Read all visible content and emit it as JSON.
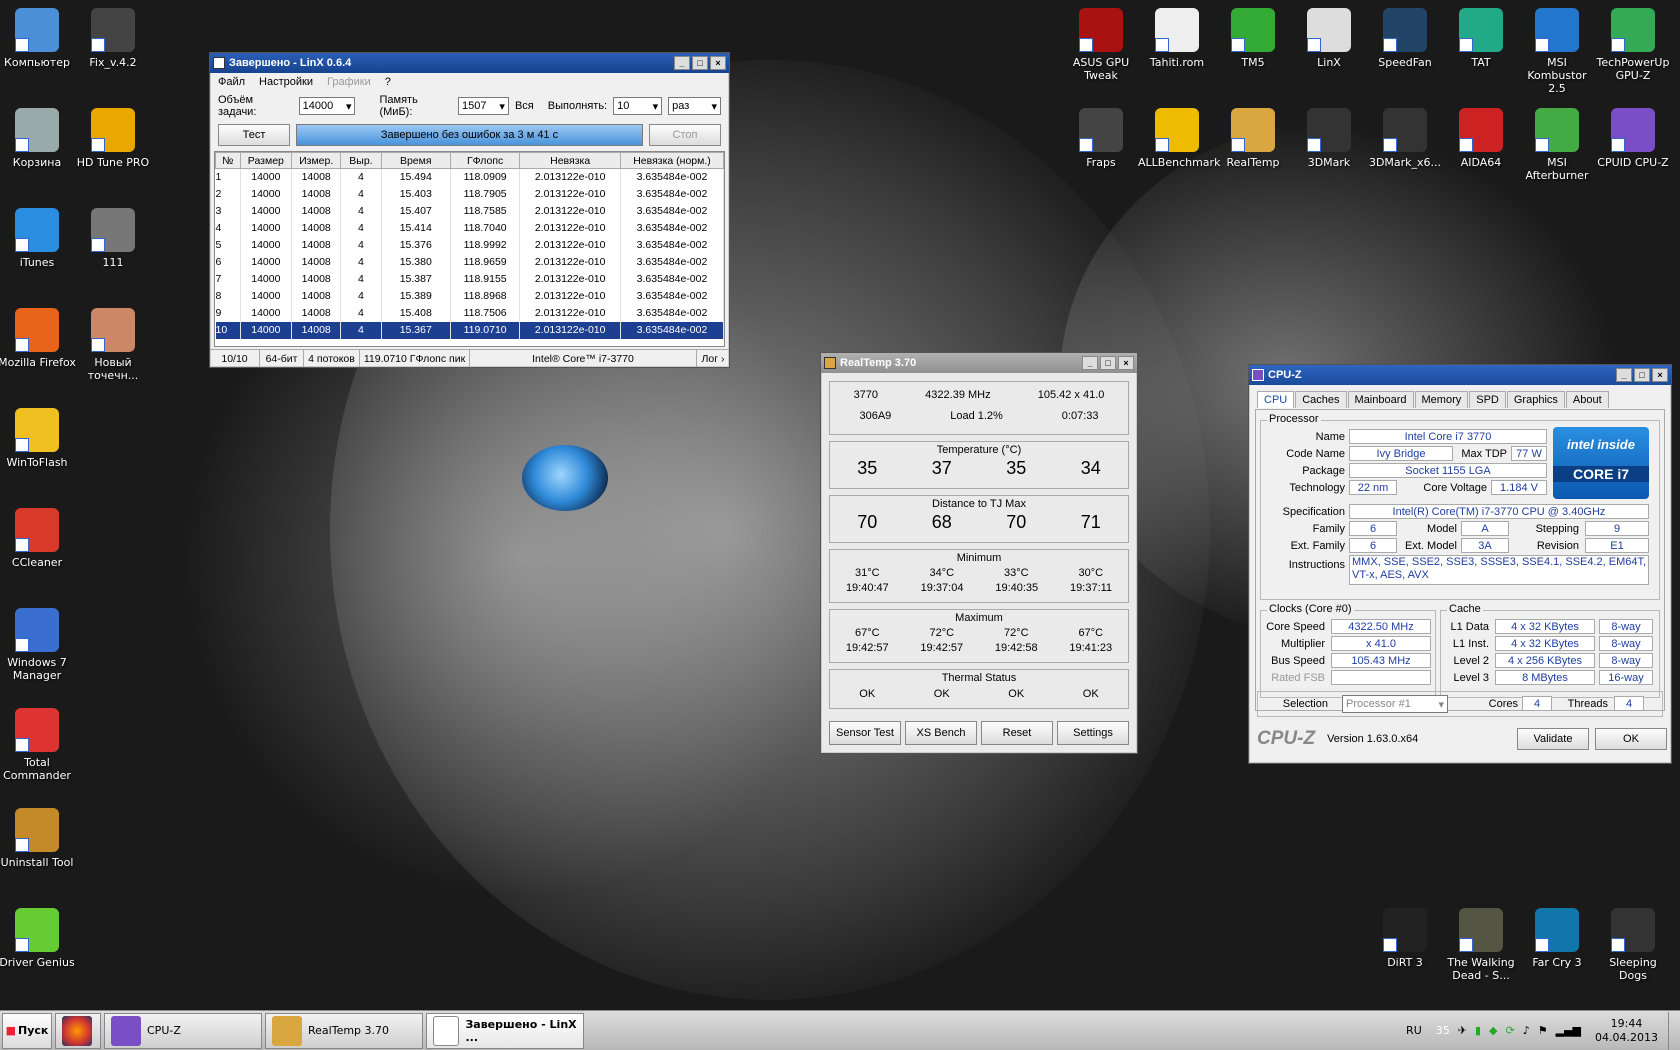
{
  "desktop": {
    "left_icons": [
      "Компьютер",
      "Корзина",
      "iTunes",
      "Mozilla Firefox",
      "WinToFlash",
      "CCleaner",
      "Windows 7 Manager",
      "Total Commander",
      "Uninstall Tool",
      "Driver Genius"
    ],
    "left2_icons": [
      "Fix_v.4.2",
      "HD Tune PRO",
      "111",
      "Новый точечн..."
    ],
    "top_icons": [
      "ASUS GPU Tweak",
      "Tahiti.rom",
      "TM5",
      "LinX",
      "SpeedFan",
      "TAT",
      "MSI Kombustor 2.5",
      "TechPowerUp GPU-Z"
    ],
    "top2_icons": [
      "Fraps",
      "ALLBenchmark",
      "RealTemp",
      "3DMark",
      "3DMark_x6...",
      "AIDA64",
      "MSI Afterburner",
      "CPUID CPU-Z"
    ],
    "bottom_icons": [
      "DiRT 3",
      "The Walking Dead - S...",
      "Far Cry 3",
      "Sleeping Dogs"
    ]
  },
  "linx": {
    "title": "Завершено - LinX 0.6.4",
    "menu": [
      "Файл",
      "Настройки",
      "Графики",
      "?"
    ],
    "size_label": "Объём задачи:",
    "size_value": "14000",
    "mem_label": "Память (МиБ):",
    "mem_value": "1507",
    "all_label": "Вся",
    "run_label": "Выполнять:",
    "run_value": "10",
    "times_value": "раз",
    "test_button": "Тест",
    "progress_text": "Завершено без ошибок за 3 м 41 с",
    "stop_button": "Стоп",
    "columns": [
      "№",
      "Размер",
      "Измер.",
      "Выр.",
      "Время",
      "ГФлопс",
      "Невязка",
      "Невязка (норм.)"
    ],
    "rows": [
      [
        "1",
        "14000",
        "14008",
        "4",
        "15.494",
        "118.0909",
        "2.013122e-010",
        "3.635484e-002"
      ],
      [
        "2",
        "14000",
        "14008",
        "4",
        "15.403",
        "118.7905",
        "2.013122e-010",
        "3.635484e-002"
      ],
      [
        "3",
        "14000",
        "14008",
        "4",
        "15.407",
        "118.7585",
        "2.013122e-010",
        "3.635484e-002"
      ],
      [
        "4",
        "14000",
        "14008",
        "4",
        "15.414",
        "118.7040",
        "2.013122e-010",
        "3.635484e-002"
      ],
      [
        "5",
        "14000",
        "14008",
        "4",
        "15.376",
        "118.9992",
        "2.013122e-010",
        "3.635484e-002"
      ],
      [
        "6",
        "14000",
        "14008",
        "4",
        "15.380",
        "118.9659",
        "2.013122e-010",
        "3.635484e-002"
      ],
      [
        "7",
        "14000",
        "14008",
        "4",
        "15.387",
        "118.9155",
        "2.013122e-010",
        "3.635484e-002"
      ],
      [
        "8",
        "14000",
        "14008",
        "4",
        "15.389",
        "118.8968",
        "2.013122e-010",
        "3.635484e-002"
      ],
      [
        "9",
        "14000",
        "14008",
        "4",
        "15.408",
        "118.7506",
        "2.013122e-010",
        "3.635484e-002"
      ],
      [
        "10",
        "14000",
        "14008",
        "4",
        "15.367",
        "119.0710",
        "2.013122e-010",
        "3.635484e-002"
      ]
    ],
    "status": [
      "10/10",
      "64-бит",
      "4 потоков",
      "119.0710 ГФлопс пик",
      "Intel® Core™ i7-3770",
      "Лог ›"
    ]
  },
  "realtemp": {
    "title": "RealTemp 3.70",
    "info": [
      "3770",
      "4322.39 MHz",
      "105.42 x 41.0",
      "306A9",
      "Load   1.2%",
      "0:07:33"
    ],
    "temp_label": "Temperature (°C)",
    "temps": [
      "35",
      "37",
      "35",
      "34"
    ],
    "dist_label": "Distance to TJ Max",
    "dists": [
      "70",
      "68",
      "70",
      "71"
    ],
    "min_label": "Minimum",
    "min_vals": [
      "31°C",
      "34°C",
      "33°C",
      "30°C"
    ],
    "min_times": [
      "19:40:47",
      "19:37:04",
      "19:40:35",
      "19:37:11"
    ],
    "max_label": "Maximum",
    "max_vals": [
      "67°C",
      "72°C",
      "72°C",
      "67°C"
    ],
    "max_times": [
      "19:42:57",
      "19:42:57",
      "19:42:58",
      "19:41:23"
    ],
    "thermal_label": "Thermal Status",
    "thermal": [
      "OK",
      "OK",
      "OK",
      "OK"
    ],
    "buttons": [
      "Sensor Test",
      "XS Bench",
      "Reset",
      "Settings"
    ]
  },
  "cpuz": {
    "title": "CPU-Z",
    "tabs": [
      "CPU",
      "Caches",
      "Mainboard",
      "Memory",
      "SPD",
      "Graphics",
      "About"
    ],
    "processor_label": "Processor",
    "name_label": "Name",
    "name": "Intel Core i7 3770",
    "codename_label": "Code Name",
    "codename": "Ivy Bridge",
    "maxtdp_label": "Max TDP",
    "maxtdp": "77 W",
    "package_label": "Package",
    "package": "Socket 1155 LGA",
    "tech_label": "Technology",
    "tech": "22 nm",
    "voltage_label": "Core Voltage",
    "voltage": "1.184 V",
    "spec_label": "Specification",
    "spec": "Intel(R) Core(TM) i7-3770 CPU @ 3.40GHz",
    "family_label": "Family",
    "family": "6",
    "model_label": "Model",
    "model": "A",
    "stepping_label": "Stepping",
    "stepping": "9",
    "extfam_label": "Ext. Family",
    "extfam": "6",
    "extmodel_label": "Ext. Model",
    "extmodel": "3A",
    "rev_label": "Revision",
    "rev": "E1",
    "instr_label": "Instructions",
    "instr": "MMX, SSE, SSE2, SSE3, SSSE3, SSE4.1, SSE4.2, EM64T, VT-x, AES, AVX",
    "clocks_label": "Clocks (Core #0)",
    "cache_label": "Cache",
    "corespeed_label": "Core Speed",
    "corespeed": "4322.50 MHz",
    "mult_label": "Multiplier",
    "mult": "x 41.0",
    "bus_label": "Bus Speed",
    "bus": "105.43 MHz",
    "fsb_label": "Rated FSB",
    "l1d_label": "L1 Data",
    "l1d": "4 x 32 KBytes",
    "l1d_way": "8-way",
    "l1i_label": "L1 Inst.",
    "l1i": "4 x 32 KBytes",
    "l1i_way": "8-way",
    "l2_label": "Level 2",
    "l2": "4 x 256 KBytes",
    "l2_way": "8-way",
    "l3_label": "Level 3",
    "l3": "8 MBytes",
    "l3_way": "16-way",
    "selection_label": "Selection",
    "selection": "Processor #1",
    "cores_label": "Cores",
    "cores": "4",
    "threads_label": "Threads",
    "threads": "4",
    "brand": "CPU-Z",
    "version": "Version 1.63.0.x64",
    "validate": "Validate",
    "ok": "OK",
    "badge_inside": "intel inside",
    "badge_core": "CORE i7"
  },
  "taskbar": {
    "start": "Пуск",
    "tasks": [
      "CPU-Z",
      "RealTemp 3.70",
      "Завершено - LinX ..."
    ],
    "lang": "RU",
    "tray_temp": "35",
    "time": "19:44",
    "date": "04.04.2013"
  },
  "colors": {
    "linx_title": "#17438f",
    "cpuz_title": "#1b4a9a",
    "selection": "#1c3f91",
    "cpuz_value": "#1f3fa0"
  }
}
